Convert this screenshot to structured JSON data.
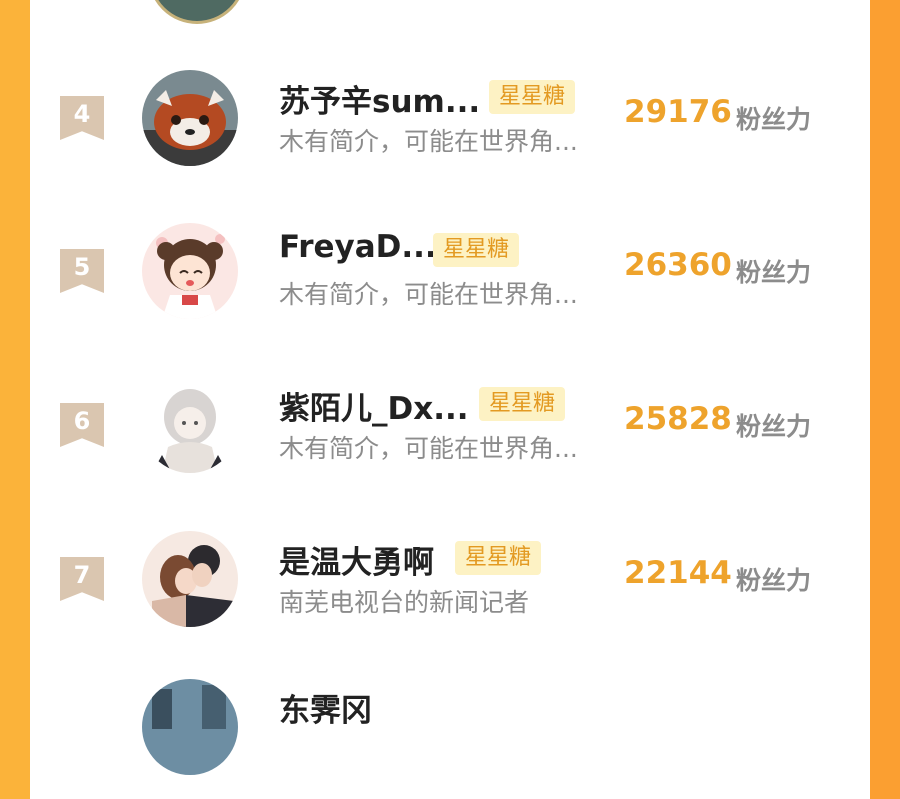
{
  "rows": [
    {
      "rank": "4",
      "name": "苏予辛sum...",
      "badge": "星星糖",
      "desc": "木有简介，可能在世界角...",
      "score": "29176",
      "unit": "粉丝力"
    },
    {
      "rank": "5",
      "name": "FreyaD...",
      "badge": "星星糖",
      "desc": "木有简介，可能在世界角...",
      "score": "26360",
      "unit": "粉丝力"
    },
    {
      "rank": "6",
      "name": "紫陌儿_Dx...",
      "badge": "星星糖",
      "desc": "木有简介，可能在世界角...",
      "score": "25828",
      "unit": "粉丝力"
    },
    {
      "rank": "7",
      "name": "是温大勇啊",
      "badge": "星星糖",
      "desc": "南芜电视台的新闻记者",
      "score": "22144",
      "unit": "粉丝力"
    },
    {
      "name": "东霁冈"
    }
  ],
  "colors": {
    "rank_bg": "#dac6b0",
    "score": "#eea32c",
    "badge_bg": "#fdf2c4",
    "badge_text": "#e39a22",
    "border_left": "#fbb33a",
    "border_right": "#fb9f31"
  }
}
